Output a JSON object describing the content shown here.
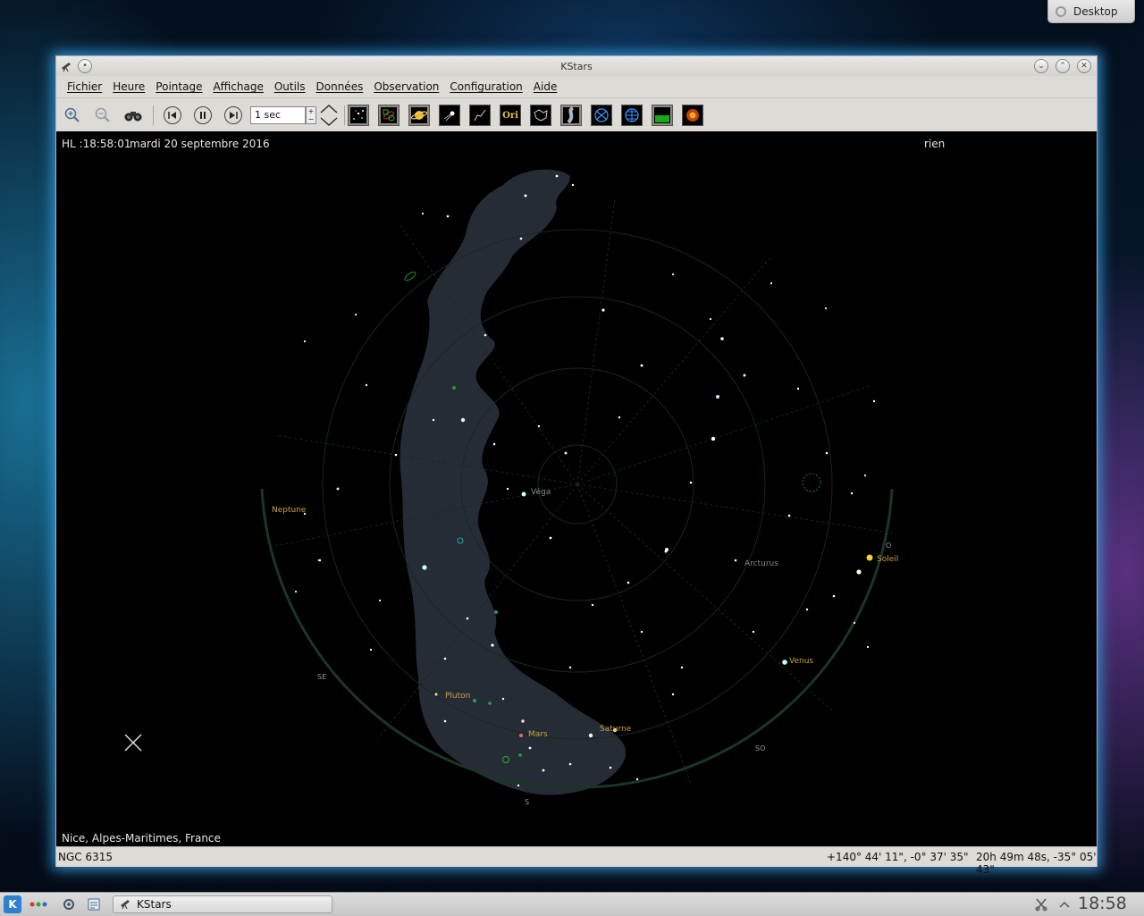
{
  "desktop": {
    "widget_label": "Desktop"
  },
  "window": {
    "title": "KStars",
    "menu": [
      "Fichier",
      "Heure",
      "Pointage",
      "Affichage",
      "Outils",
      "Données",
      "Observation",
      "Configuration",
      "Aide"
    ],
    "toolbar": {
      "time_step": "1 sec",
      "icons": [
        "zoom-in-icon",
        "zoom-out-icon",
        "binoculars-icon",
        "back-icon",
        "pause-icon",
        "forward-icon",
        "stars-icon",
        "deep-sky-icon",
        "planets-icon",
        "comets-icon",
        "constellation-lines-icon",
        "constellation-names-icon",
        "constellation-boundaries-icon",
        "milky-way-icon",
        "equatorial-grid-icon",
        "horizontal-grid-icon",
        "ground-icon",
        "image-overlay-icon"
      ],
      "constellation_names_glyph": "Ori"
    }
  },
  "sky": {
    "local_time": "HL :18:58:01",
    "date": "mardi 20 septembre 2016",
    "focus_object": "rien",
    "location": "Nice, Alpes-Maritimes, France",
    "labels": {
      "vega": "Véga",
      "arcturus": "Arcturus",
      "soleil": "Soleil",
      "venus": "Venus",
      "saturne": "Saturne",
      "mars": "Mars",
      "pluton": "Pluton",
      "neptune": "Neptune"
    },
    "compass": {
      "s": "S",
      "se": "SE",
      "so": "SO",
      "o": "O"
    }
  },
  "status": {
    "object": "NGC 6315",
    "alt_az": "+140° 44' 11\", -0° 37' 35\"",
    "ra_dec": "20h 49m 48s, -35° 05' 43\""
  },
  "taskbar": {
    "task_label": "KStars",
    "clock": "18:58"
  },
  "colors": {
    "sky_bg": "#000000",
    "milky_way": "#2a313c",
    "grid": "#1c3a2c",
    "planet_label": "#c9a23a",
    "star_label": "#7e8b96"
  }
}
